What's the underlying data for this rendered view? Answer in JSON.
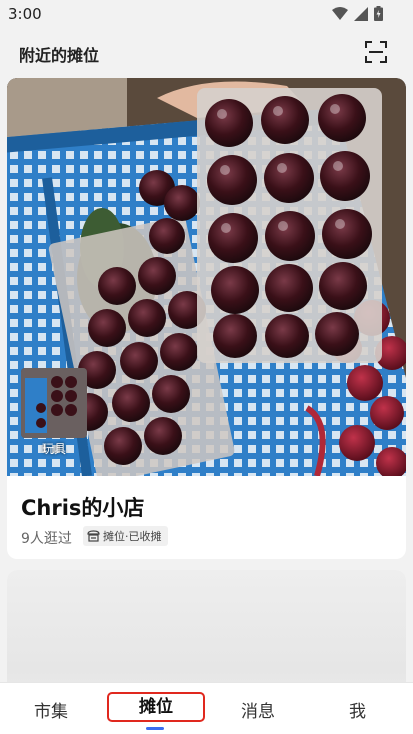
{
  "status_bar": {
    "time": "3:00",
    "icons": [
      "wifi-icon",
      "signal-icon",
      "battery-icon"
    ]
  },
  "header": {
    "title": "附近的摊位",
    "scan_icon": "scan-icon"
  },
  "stalls": [
    {
      "thumbnail_label": "玩具",
      "name": "Chris的小店",
      "visit_count": "9人逛过",
      "status_badge": "摊位·已收摊",
      "status_icon": "stall-icon"
    }
  ],
  "bottom_nav": {
    "items": [
      {
        "label": "市集"
      },
      {
        "label": "摊位",
        "selected": true
      },
      {
        "label": "消息"
      },
      {
        "label": "我"
      }
    ]
  },
  "colors": {
    "highlight_border": "#e0281e",
    "indicator": "#3b6cf0",
    "background": "#f2f2f2"
  }
}
